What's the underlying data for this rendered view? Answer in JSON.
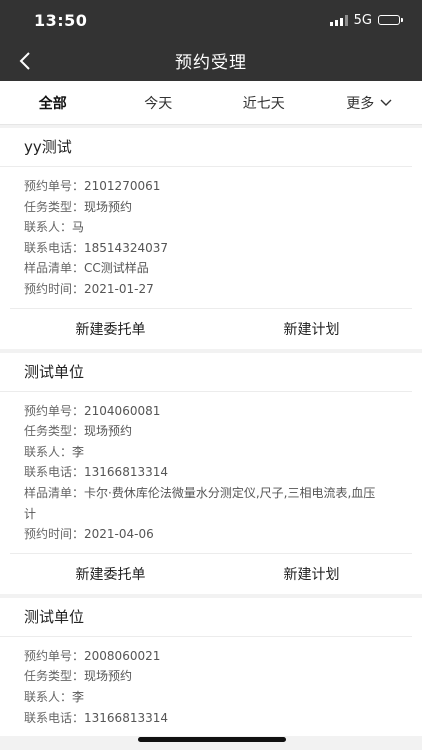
{
  "status_bar": {
    "time": "13:50",
    "network": "5G",
    "battery_level": 0.7
  },
  "nav": {
    "title": "预约受理",
    "back_icon": "chevron-left-icon"
  },
  "tabs": [
    {
      "label": "全部",
      "active": true
    },
    {
      "label": "今天",
      "active": false
    },
    {
      "label": "近七天",
      "active": false
    },
    {
      "label": "更多",
      "active": false,
      "icon": "chevron-down-icon"
    }
  ],
  "cards": [
    {
      "title": "yy测试",
      "fields": [
        {
          "label": "预约单号：",
          "value": "2101270061"
        },
        {
          "label": "任务类型：",
          "value": "现场预约"
        },
        {
          "label": "联系人：",
          "value": "马"
        },
        {
          "label": "联系电话：",
          "value": "18514324037"
        },
        {
          "label": "样品清单：",
          "value": "CC测试样品"
        },
        {
          "label": "预约时间：",
          "value": "2021-01-27"
        }
      ],
      "actions": [
        "新建委托单",
        "新建计划"
      ]
    },
    {
      "title": "测试单位",
      "fields": [
        {
          "label": "预约单号：",
          "value": "2104060081"
        },
        {
          "label": "任务类型：",
          "value": "现场预约"
        },
        {
          "label": "联系人：",
          "value": "李"
        },
        {
          "label": "联系电话：",
          "value": "13166813314"
        },
        {
          "label": "样品清单：",
          "value": "卡尔·费休库伦法微量水分测定仪,尺子,三相电流表,血压计"
        },
        {
          "label": "预约时间：",
          "value": "2021-04-06"
        }
      ],
      "actions": [
        "新建委托单",
        "新建计划"
      ]
    },
    {
      "title": "测试单位",
      "fields": [
        {
          "label": "预约单号：",
          "value": "2008060021"
        },
        {
          "label": "任务类型：",
          "value": "现场预约"
        },
        {
          "label": "联系人：",
          "value": "李"
        },
        {
          "label": "联系电话：",
          "value": "13166813314"
        }
      ],
      "actions": []
    }
  ]
}
